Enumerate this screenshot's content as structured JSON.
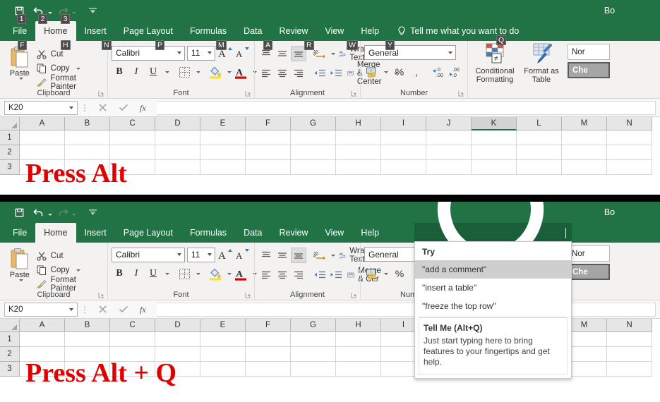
{
  "colors": {
    "excel_green": "#217346",
    "search_active_green": "#1b5e3a",
    "ribbon_bg": "#f3f2f1",
    "red_text": "#e00000",
    "keytip_bg": "#4b4b4b",
    "highlight_gray": "#cfcfcf"
  },
  "window_top": {
    "title": "Bo",
    "quick_access": [
      {
        "name": "save",
        "keytip": "1"
      },
      {
        "name": "undo",
        "keytip": "2"
      },
      {
        "name": "redo",
        "keytip": "3"
      },
      {
        "name": "customize-quick-access-toolbar",
        "keytip": ""
      }
    ],
    "tabs": [
      {
        "label": "File",
        "keytip": "F",
        "active": false
      },
      {
        "label": "Home",
        "keytip": "H",
        "active": true
      },
      {
        "label": "Insert",
        "keytip": "N",
        "active": false
      },
      {
        "label": "Page Layout",
        "keytip": "P",
        "active": false
      },
      {
        "label": "Formulas",
        "keytip": "M",
        "active": false
      },
      {
        "label": "Data",
        "keytip": "A",
        "active": false
      },
      {
        "label": "Review",
        "keytip": "R",
        "active": false
      },
      {
        "label": "View",
        "keytip": "W",
        "active": false
      },
      {
        "label": "Help",
        "keytip": "Y",
        "active": false
      }
    ],
    "tell_me": {
      "label": "Tell me what you want to do",
      "keytip": "Q"
    },
    "name_box": "K20",
    "formula_value": "",
    "sheet_text": "Press Alt",
    "selected_column": "K",
    "columns": [
      "A",
      "B",
      "C",
      "D",
      "E",
      "F",
      "G",
      "H",
      "I",
      "J",
      "K",
      "L",
      "M",
      "N"
    ],
    "rows": [
      "1",
      "2",
      "3"
    ]
  },
  "window_bottom": {
    "title": "Bo",
    "quick_access": [
      {
        "name": "save",
        "keytip": ""
      },
      {
        "name": "undo",
        "keytip": ""
      },
      {
        "name": "redo",
        "keytip": ""
      },
      {
        "name": "customize-quick-access-toolbar",
        "keytip": ""
      }
    ],
    "tabs": [
      {
        "label": "File",
        "active": false
      },
      {
        "label": "Home",
        "active": true
      },
      {
        "label": "Insert",
        "active": false
      },
      {
        "label": "Page Layout",
        "active": false
      },
      {
        "label": "Formulas",
        "active": false
      },
      {
        "label": "Data",
        "active": false
      },
      {
        "label": "Review",
        "active": false
      },
      {
        "label": "View",
        "active": false
      },
      {
        "label": "Help",
        "active": false
      }
    ],
    "search": {
      "value": "",
      "placeholder": ""
    },
    "name_box": "K20",
    "formula_value": "",
    "sheet_text": "Press Alt + Q",
    "columns": [
      "A",
      "B",
      "C",
      "D",
      "E",
      "F",
      "G",
      "H",
      "I",
      "J",
      "K",
      "L",
      "M",
      "N"
    ],
    "rows": [
      "1",
      "2",
      "3"
    ],
    "dropdown": {
      "heading": "Try",
      "suggestions": [
        {
          "text": "\"add a comment\"",
          "highlighted": true
        },
        {
          "text": "\"insert a table\"",
          "highlighted": false
        },
        {
          "text": "\"freeze the top row\"",
          "highlighted": false
        }
      ],
      "footer_title": "Tell Me (Alt+Q)",
      "footer_body": "Just start typing here to bring features to your fingertips and get help."
    }
  },
  "ribbon": {
    "clipboard": {
      "group_label": "Clipboard",
      "paste_label": "Paste",
      "cut_label": "Cut",
      "copy_label": "Copy",
      "format_painter_label": "Format Painter"
    },
    "font": {
      "group_label": "Font",
      "font_name": "Calibri",
      "font_size": "11",
      "bold": "B",
      "italic": "I",
      "underline": "U"
    },
    "alignment": {
      "group_label": "Alignment",
      "wrap_text_label": "Wrap Text",
      "merge_center_label": "Merge & Center",
      "merge_center_label_clipped": "Merge & Cer"
    },
    "number": {
      "group_label": "Number",
      "format": "General",
      "percent": "%",
      "comma": ","
    },
    "styles": {
      "conditional_formatting_line1": "Conditional",
      "conditional_formatting_line2": "Formatting",
      "format_as_table_line1": "Format as",
      "format_as_table_line2": "Table",
      "style_normal": "Nor",
      "style_check_cell": "Che"
    }
  }
}
